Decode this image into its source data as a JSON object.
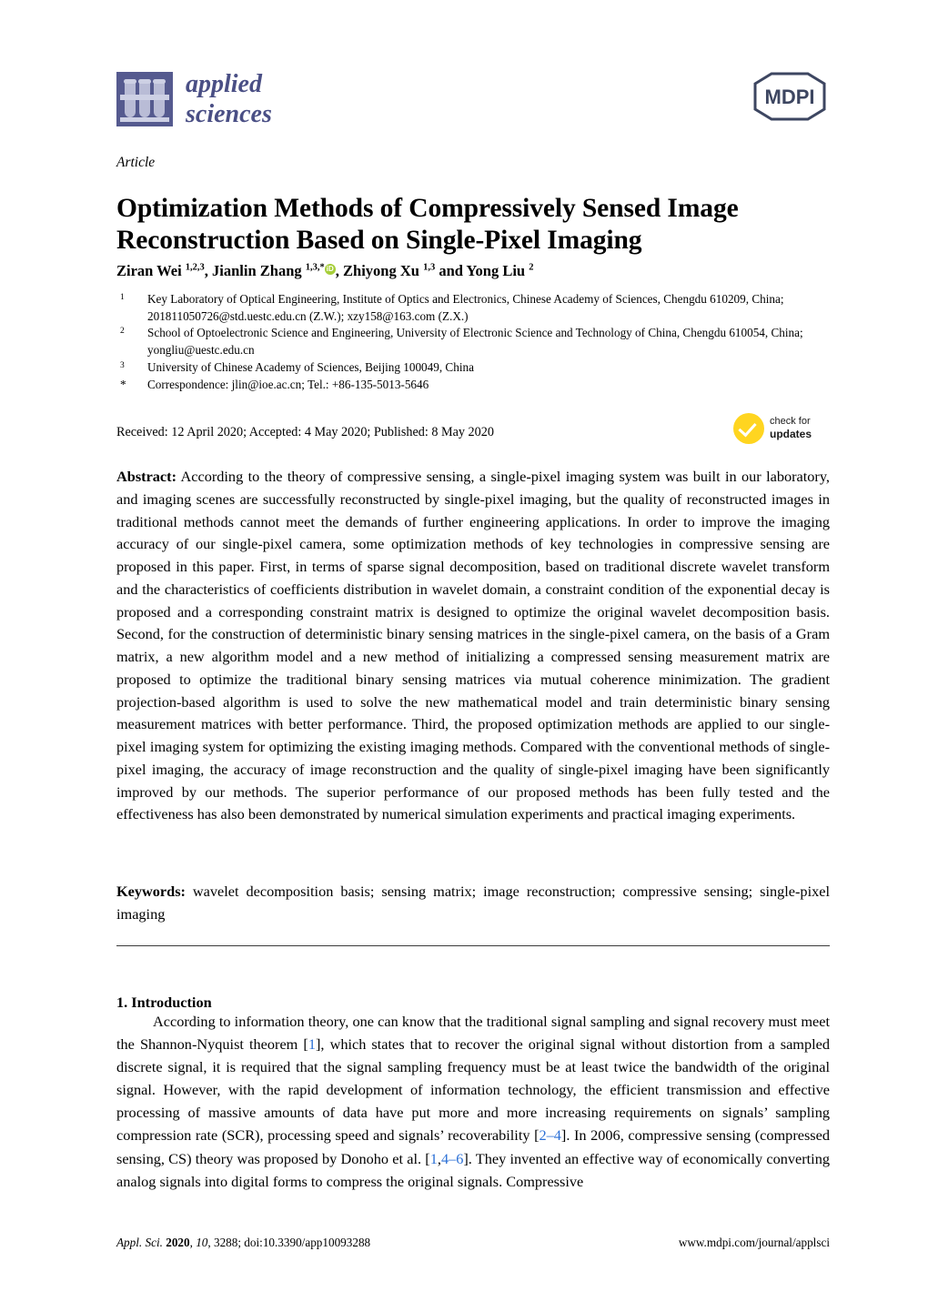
{
  "journal": {
    "logo_line1": "applied",
    "logo_line2": "sciences",
    "publisher_mark": "MDPI"
  },
  "article_type": "Article",
  "title": "Optimization Methods of Compressively Sensed Image Reconstruction Based on Single-Pixel Imaging",
  "authors_html": "Ziran Wei <sup>1,2,3</sup>, Jianlin Zhang <sup>1,3,*</sup><span class=\"orcid\" data-name=\"orcid-icon\" data-interactable=\"true\">iD</span>, Zhiyong Xu <sup>1,3</sup> and Yong Liu <sup>2</sup>",
  "affiliations": [
    {
      "marker": "1",
      "text": "Key Laboratory of Optical Engineering, Institute of Optics and Electronics, Chinese Academy of Sciences, Chengdu 610209, China; 201811050726@std.uestc.edu.cn (Z.W.); xzy158@163.com (Z.X.)"
    },
    {
      "marker": "2",
      "text": "School of Optoelectronic Science and Engineering, University of Electronic Science and Technology of China, Chengdu 610054, China; yongliu@uestc.edu.cn"
    },
    {
      "marker": "3",
      "text": "University of Chinese Academy of Sciences, Beijing 100049, China"
    },
    {
      "marker": "*",
      "text": "Correspondence: jlin@ioe.ac.cn; Tel.: +86-135-5013-5646"
    }
  ],
  "dates": "Received: 12 April 2020; Accepted: 4 May 2020; Published: 8 May 2020",
  "check_badge": {
    "line1": "check for",
    "line2": "updates"
  },
  "abstract": {
    "label": "Abstract:",
    "text": "According to the theory of compressive sensing, a single-pixel imaging system was built in our laboratory, and imaging scenes are successfully reconstructed by single-pixel imaging, but the quality of reconstructed images in traditional methods cannot meet the demands of further engineering applications. In order to improve the imaging accuracy of our single-pixel camera, some optimization methods of key technologies in compressive sensing are proposed in this paper. First, in terms of sparse signal decomposition, based on traditional discrete wavelet transform and the characteristics of coefficients distribution in wavelet domain, a constraint condition of the exponential decay is proposed and a corresponding constraint matrix is designed to optimize the original wavelet decomposition basis. Second, for the construction of deterministic binary sensing matrices in the single-pixel camera, on the basis of a Gram matrix, a new algorithm model and a new method of initializing a compressed sensing measurement matrix are proposed to optimize the traditional binary sensing matrices via mutual coherence minimization. The gradient projection-based algorithm is used to solve the new mathematical model and train deterministic binary sensing measurement matrices with better performance. Third, the proposed optimization methods are applied to our single-pixel imaging system for optimizing the existing imaging methods. Compared with the conventional methods of single-pixel imaging, the accuracy of image reconstruction and the quality of single-pixel imaging have been significantly improved by our methods. The superior performance of our proposed methods has been fully tested and the effectiveness has also been demonstrated by numerical simulation experiments and practical imaging experiments."
  },
  "keywords": {
    "label": "Keywords:",
    "text": "wavelet decomposition basis; sensing matrix; image reconstruction; compressive sensing; single-pixel imaging"
  },
  "section": {
    "heading": "1. Introduction",
    "body_html": "According to information theory, one can know that the traditional signal sampling and signal recovery must meet the Shannon-Nyquist theorem [<span class=\"ref\">1</span>], which states that to recover the original signal without distortion from a sampled discrete signal, it is required that the signal sampling frequency must be at least twice the bandwidth of the original signal. However, with the rapid development of information technology, the efficient transmission and effective processing of massive amounts of data have put more and more increasing requirements on signals&rsquo; sampling compression rate (SCR), processing speed and signals&rsquo; recoverability [<span class=\"ref\">2&ndash;4</span>]. In 2006, compressive sensing (compressed sensing, CS) theory was proposed by Donoho et al. [<span class=\"ref\">1</span>,<span class=\"ref\">4&ndash;6</span>]. They invented an effective way of economically converting analog signals into digital forms to compress the original signals. Compressive"
  },
  "footer": {
    "citation_html": "<i>Appl. Sci.</i> <b>2020</b>, <i>10</i>, 3288; doi:10.3390/app10093288",
    "url": "www.mdpi.com/journal/applsci"
  },
  "colors": {
    "logo_purple": "#555a8f",
    "logo_text": "#4a4f85",
    "mdpi_navy": "#3d4661",
    "orcid_green": "#a6ce39",
    "badge_yellow": "#ffd520",
    "reference_blue": "#2a6fd6"
  }
}
